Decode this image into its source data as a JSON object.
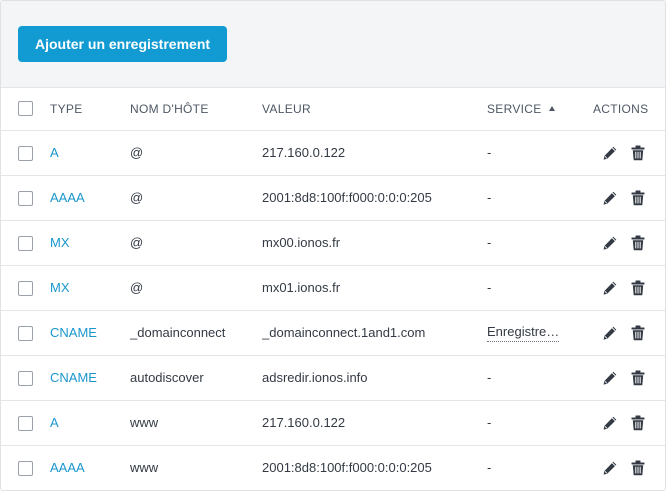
{
  "toolbar": {
    "add_label": "Ajouter un enregistrement"
  },
  "table": {
    "headers": {
      "type": "TYPE",
      "host": "NOM D'HÔTE",
      "value": "VALEUR",
      "service": "SERVICE",
      "actions": "ACTIONS"
    },
    "sort": {
      "column": "service",
      "direction": "ascending"
    },
    "rows": [
      {
        "type": "A",
        "host": "@",
        "value": "217.160.0.122",
        "service": "-"
      },
      {
        "type": "AAAA",
        "host": "@",
        "value": "2001:8d8:100f:f000:0:0:0:205",
        "service": "-"
      },
      {
        "type": "MX",
        "host": "@",
        "value": "mx00.ionos.fr",
        "service": "-"
      },
      {
        "type": "MX",
        "host": "@",
        "value": "mx01.ionos.fr",
        "service": "-"
      },
      {
        "type": "CNAME",
        "host": "_domainconnect",
        "value": "_domainconnect.1and1.com",
        "service": "Enregistre…"
      },
      {
        "type": "CNAME",
        "host": "autodiscover",
        "value": "adsredir.ionos.info",
        "service": "-"
      },
      {
        "type": "A",
        "host": "www",
        "value": "217.160.0.122",
        "service": "-"
      },
      {
        "type": "AAAA",
        "host": "www",
        "value": "2001:8d8:100f:f000:0:0:0:205",
        "service": "-"
      }
    ]
  },
  "icons": {
    "edit": "pencil-icon",
    "delete": "trash-icon"
  },
  "colors": {
    "accent": "#119bd2",
    "link": "#1a96cc",
    "icon": "#333a44"
  }
}
